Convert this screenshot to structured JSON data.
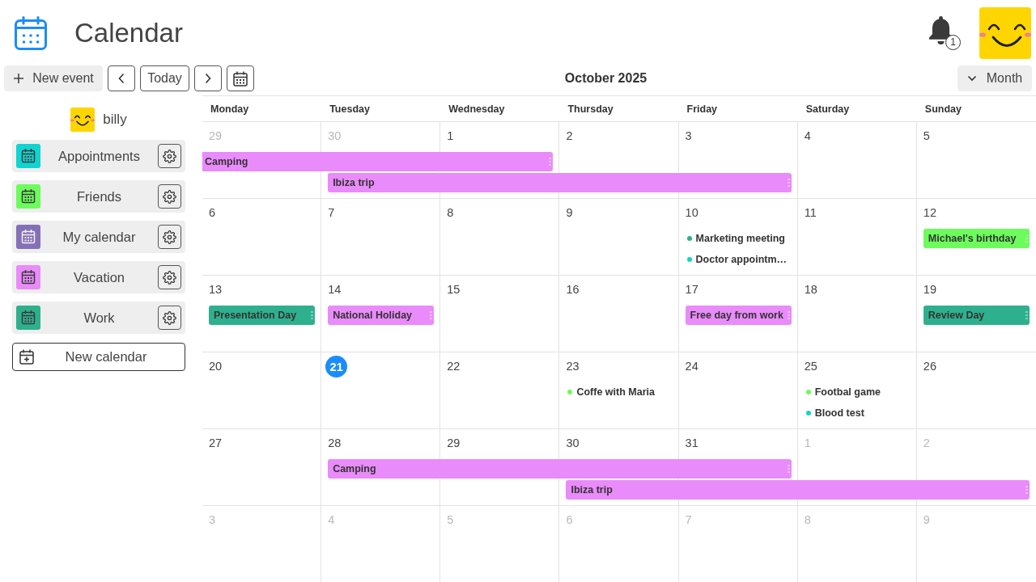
{
  "header": {
    "title": "Calendar",
    "notifications": {
      "count": "1"
    }
  },
  "toolbar": {
    "new_event": "New event",
    "today": "Today",
    "month_title": "October 2025",
    "view": "Month"
  },
  "sidebar": {
    "user": "billy",
    "calendars": [
      {
        "name": "Appointments",
        "color": "#10d4d0"
      },
      {
        "name": "Friends",
        "color": "#6cfc5c"
      },
      {
        "name": "My calendar",
        "color": "#8570b8"
      },
      {
        "name": "Vacation",
        "color": "#e98bfa"
      },
      {
        "name": "Work",
        "color": "#2eb08e"
      }
    ],
    "new_calendar": "New calendar"
  },
  "calendar": {
    "weekdays": [
      "Monday",
      "Tuesday",
      "Wednesday",
      "Thursday",
      "Friday",
      "Saturday",
      "Sunday"
    ],
    "weeks": [
      {
        "days": [
          {
            "number": "29",
            "in_month": false,
            "today": false
          },
          {
            "number": "30",
            "in_month": false,
            "today": false
          },
          {
            "number": "1",
            "in_month": true,
            "today": false
          },
          {
            "number": "2",
            "in_month": true,
            "today": false
          },
          {
            "number": "3",
            "in_month": true,
            "today": false
          },
          {
            "number": "4",
            "in_month": true,
            "today": false
          },
          {
            "number": "5",
            "in_month": true,
            "today": false
          }
        ],
        "lanes": [
          {
            "slots": [
              {
                "kind": "bar",
                "title": "Camping",
                "color": "#e98bfa",
                "continues_before": true
              },
              {
                "kind": "continued"
              },
              {
                "kind": "continued"
              }
            ]
          },
          {
            "slots": [
              {
                "kind": "free"
              },
              {
                "kind": "bar",
                "title": "Ibiza trip",
                "color": "#e98bfa",
                "continues_before": false
              },
              {
                "kind": "continued"
              },
              {
                "kind": "continued"
              },
              {
                "kind": "continued"
              }
            ]
          }
        ]
      },
      {
        "days": [
          {
            "number": "6",
            "in_month": true,
            "today": false
          },
          {
            "number": "7",
            "in_month": true,
            "today": false
          },
          {
            "number": "8",
            "in_month": true,
            "today": false
          },
          {
            "number": "9",
            "in_month": true,
            "today": false
          },
          {
            "number": "10",
            "in_month": true,
            "today": false
          },
          {
            "number": "11",
            "in_month": true,
            "today": false
          },
          {
            "number": "12",
            "in_month": true,
            "today": false
          }
        ],
        "lanes": [
          {
            "slots": [
              {
                "kind": "free"
              },
              {
                "kind": "free"
              },
              {
                "kind": "free"
              },
              {
                "kind": "free"
              },
              {
                "kind": "dot",
                "title": "Marketing meeting",
                "color": "#2eb08e"
              },
              {
                "kind": "free"
              },
              {
                "kind": "bar",
                "title": "Michael's birthday",
                "color": "#6cfc5c",
                "continues_before": false
              }
            ]
          },
          {
            "slots": [
              {
                "kind": "free"
              },
              {
                "kind": "free"
              },
              {
                "kind": "free"
              },
              {
                "kind": "free"
              },
              {
                "kind": "dot",
                "title": "Doctor appointm…",
                "color": "#10d4d0"
              }
            ]
          }
        ]
      },
      {
        "days": [
          {
            "number": "13",
            "in_month": true,
            "today": false
          },
          {
            "number": "14",
            "in_month": true,
            "today": false
          },
          {
            "number": "15",
            "in_month": true,
            "today": false
          },
          {
            "number": "16",
            "in_month": true,
            "today": false
          },
          {
            "number": "17",
            "in_month": true,
            "today": false
          },
          {
            "number": "18",
            "in_month": true,
            "today": false
          },
          {
            "number": "19",
            "in_month": true,
            "today": false
          }
        ],
        "lanes": [
          {
            "slots": [
              {
                "kind": "bar",
                "title": "Presentation Day",
                "color": "#2eb08e",
                "continues_before": false
              },
              {
                "kind": "bar",
                "title": "National Holiday",
                "color": "#e98bfa",
                "continues_before": false
              },
              {
                "kind": "free"
              },
              {
                "kind": "free"
              },
              {
                "kind": "bar",
                "title": "Free day from work",
                "color": "#e98bfa",
                "continues_before": false
              },
              {
                "kind": "free"
              },
              {
                "kind": "bar",
                "title": "Review Day",
                "color": "#2eb08e",
                "continues_before": false
              }
            ]
          }
        ]
      },
      {
        "days": [
          {
            "number": "20",
            "in_month": true,
            "today": false
          },
          {
            "number": "21",
            "in_month": true,
            "today": true
          },
          {
            "number": "22",
            "in_month": true,
            "today": false
          },
          {
            "number": "23",
            "in_month": true,
            "today": false
          },
          {
            "number": "24",
            "in_month": true,
            "today": false
          },
          {
            "number": "25",
            "in_month": true,
            "today": false
          },
          {
            "number": "26",
            "in_month": true,
            "today": false
          }
        ],
        "lanes": [
          {
            "slots": [
              {
                "kind": "free"
              },
              {
                "kind": "free"
              },
              {
                "kind": "free"
              },
              {
                "kind": "dot",
                "title": "Coffe with Maria",
                "color": "#6cfc5c"
              },
              {
                "kind": "free"
              },
              {
                "kind": "dot",
                "title": "Footbal game",
                "color": "#6cfc5c"
              }
            ]
          },
          {
            "slots": [
              {
                "kind": "free"
              },
              {
                "kind": "free"
              },
              {
                "kind": "free"
              },
              {
                "kind": "free"
              },
              {
                "kind": "free"
              },
              {
                "kind": "dot",
                "title": "Blood test",
                "color": "#10d4d0"
              }
            ]
          }
        ]
      },
      {
        "days": [
          {
            "number": "27",
            "in_month": true,
            "today": false
          },
          {
            "number": "28",
            "in_month": true,
            "today": false
          },
          {
            "number": "29",
            "in_month": true,
            "today": false
          },
          {
            "number": "30",
            "in_month": true,
            "today": false
          },
          {
            "number": "31",
            "in_month": true,
            "today": false
          },
          {
            "number": "1",
            "in_month": false,
            "today": false
          },
          {
            "number": "2",
            "in_month": false,
            "today": false
          }
        ],
        "lanes": [
          {
            "slots": [
              {
                "kind": "free"
              },
              {
                "kind": "bar",
                "title": "Camping",
                "color": "#e98bfa",
                "continues_before": false
              },
              {
                "kind": "continued"
              },
              {
                "kind": "continued"
              },
              {
                "kind": "continued"
              }
            ]
          },
          {
            "slots": [
              {
                "kind": "free"
              },
              {
                "kind": "free"
              },
              {
                "kind": "free"
              },
              {
                "kind": "bar",
                "title": "Ibiza trip",
                "color": "#e98bfa",
                "continues_before": false
              },
              {
                "kind": "continued"
              },
              {
                "kind": "continued"
              },
              {
                "kind": "continued"
              }
            ]
          }
        ]
      },
      {
        "days": [
          {
            "number": "3",
            "in_month": false,
            "today": false
          },
          {
            "number": "4",
            "in_month": false,
            "today": false
          },
          {
            "number": "5",
            "in_month": false,
            "today": false
          },
          {
            "number": "6",
            "in_month": false,
            "today": false
          },
          {
            "number": "7",
            "in_month": false,
            "today": false
          },
          {
            "number": "8",
            "in_month": false,
            "today": false
          },
          {
            "number": "9",
            "in_month": false,
            "today": false
          }
        ]
      }
    ]
  }
}
